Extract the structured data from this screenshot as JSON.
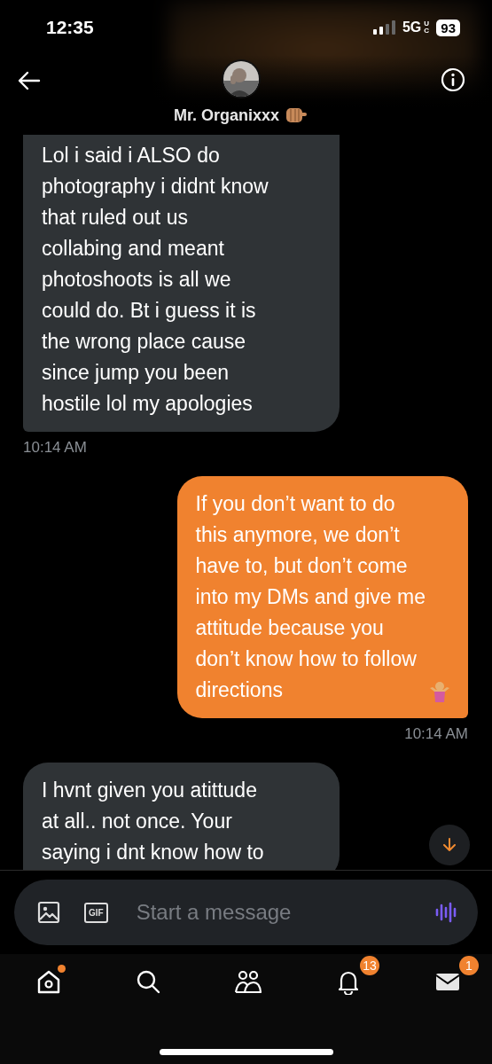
{
  "status_bar": {
    "time": "12:35",
    "network": "5G",
    "network_suffix": "UC",
    "battery": "93"
  },
  "header": {
    "name": "Mr. Organixxx"
  },
  "messages": [
    {
      "kind": "received",
      "text": "Lol i said i ALSO do\nphotography i didnt know\nthat ruled out us\ncollabing and meant\nphotoshoots is all we\ncould do. Bt i guess it is\nthe wrong place cause\nsince jump you been\nhostile lol my apologies",
      "time": "10:14 AM"
    },
    {
      "kind": "sent",
      "text": "If you don’t want to do\nthis anymore, we don’t\nhave to, but don’t come\ninto my DMs and give me\nattitude because you\ndon’t know how to follow\ndirections",
      "time": "10:14 AM"
    },
    {
      "kind": "received",
      "text": "I hvnt given you atittude\nat all.. not once. Your\nsaying i dnt know how to"
    }
  ],
  "composer": {
    "placeholder": "Start a message",
    "gif": "GIF"
  },
  "nav": [
    {
      "kind": "home",
      "dot": true
    },
    {
      "kind": "search"
    },
    {
      "kind": "people"
    },
    {
      "kind": "bell",
      "badge": "13"
    },
    {
      "kind": "mail",
      "badge": "1"
    }
  ]
}
